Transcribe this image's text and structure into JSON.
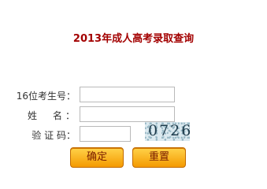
{
  "form": {
    "title": "2013年成人高考录取查询",
    "fields": [
      {
        "label": "16位考生号：",
        "value": ""
      },
      {
        "label": "姓　名：",
        "value": ""
      },
      {
        "label": "验 证 码：",
        "value": ""
      }
    ],
    "captcha_code": "0726",
    "submit_label": "确定",
    "reset_label": "重置"
  }
}
